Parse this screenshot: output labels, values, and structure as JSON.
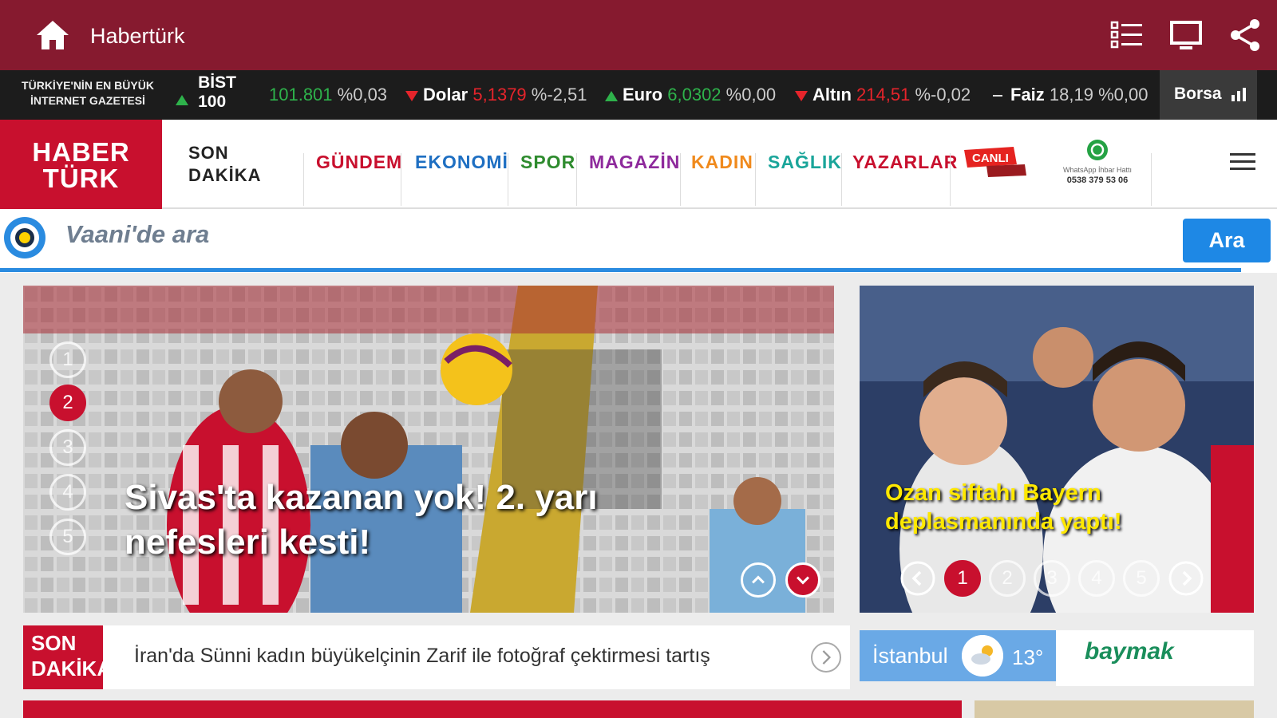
{
  "appbar": {
    "title": "Habertürk",
    "icons": [
      "home-icon",
      "list-icon",
      "monitor-icon",
      "share-icon"
    ]
  },
  "ticker": {
    "slogan": "TÜRKİYE'NİN EN BÜYÜK İNTERNET GAZETESİ",
    "bist_label": "BİST 100",
    "bist_value": "101.801",
    "bist_change": "%0,03",
    "dolar_label": "Dolar",
    "dolar_value": "5,1379",
    "dolar_change": "%-2,51",
    "euro_label": "Euro",
    "euro_value": "6,0302",
    "euro_change": "%0,00",
    "altin_label": "Altın",
    "altin_value": "214,51",
    "altin_change": "%-0,02",
    "faiz_label": "Faiz",
    "faiz_value": "18,19",
    "faiz_change": "%0,00",
    "borsa_label": "Borsa"
  },
  "nav": {
    "logo_line1": "HABER",
    "logo_line2": "TÜRK",
    "son_dakika_line1": "SON",
    "son_dakika_line2": "DAKİKA",
    "categories": [
      {
        "label": "GÜNDEM",
        "color": "#c8102e"
      },
      {
        "label": "EKONOMİ",
        "color": "#1e6fc2"
      },
      {
        "label": "SPOR",
        "color": "#2e8b2e"
      },
      {
        "label": "MAGAZİN",
        "color": "#8e2a9c"
      },
      {
        "label": "KADIN",
        "color": "#f08a1d"
      },
      {
        "label": "SAĞLIK",
        "color": "#1aa59a"
      },
      {
        "label": "YAZARLAR",
        "color": "#c8102e"
      }
    ],
    "canli_label": "CANLI",
    "whatsapp_label": "WhatsApp İhbar Hattı",
    "whatsapp_number": "0538 379 53 06"
  },
  "search": {
    "placeholder": "Vaani'de ara",
    "button": "Ara"
  },
  "hero": {
    "headline": "Sivas'ta kazanan yok! 2. yarı nefesleri kesti!",
    "dots": [
      "1",
      "2",
      "3",
      "4",
      "5"
    ],
    "active_dot": 2
  },
  "side": {
    "headline": "Ozan siftahı Bayern deplasmanında yaptı!",
    "pages": [
      "1",
      "2",
      "3",
      "4",
      "5"
    ],
    "active_page": 1
  },
  "breaking": {
    "tag_line1": "SON",
    "tag_line2": "DAKİKA",
    "text": "İran'da Sünni kadın büyükelçinin Zarif ile fotoğraf çektirmesi tartış"
  },
  "weather": {
    "city": "İstanbul",
    "temp": "13°"
  },
  "ad": {
    "brand": "baymak"
  },
  "colors": {
    "appbar": "#861a2f",
    "brand_red": "#c8102e",
    "search_blue": "#1e88e5"
  }
}
